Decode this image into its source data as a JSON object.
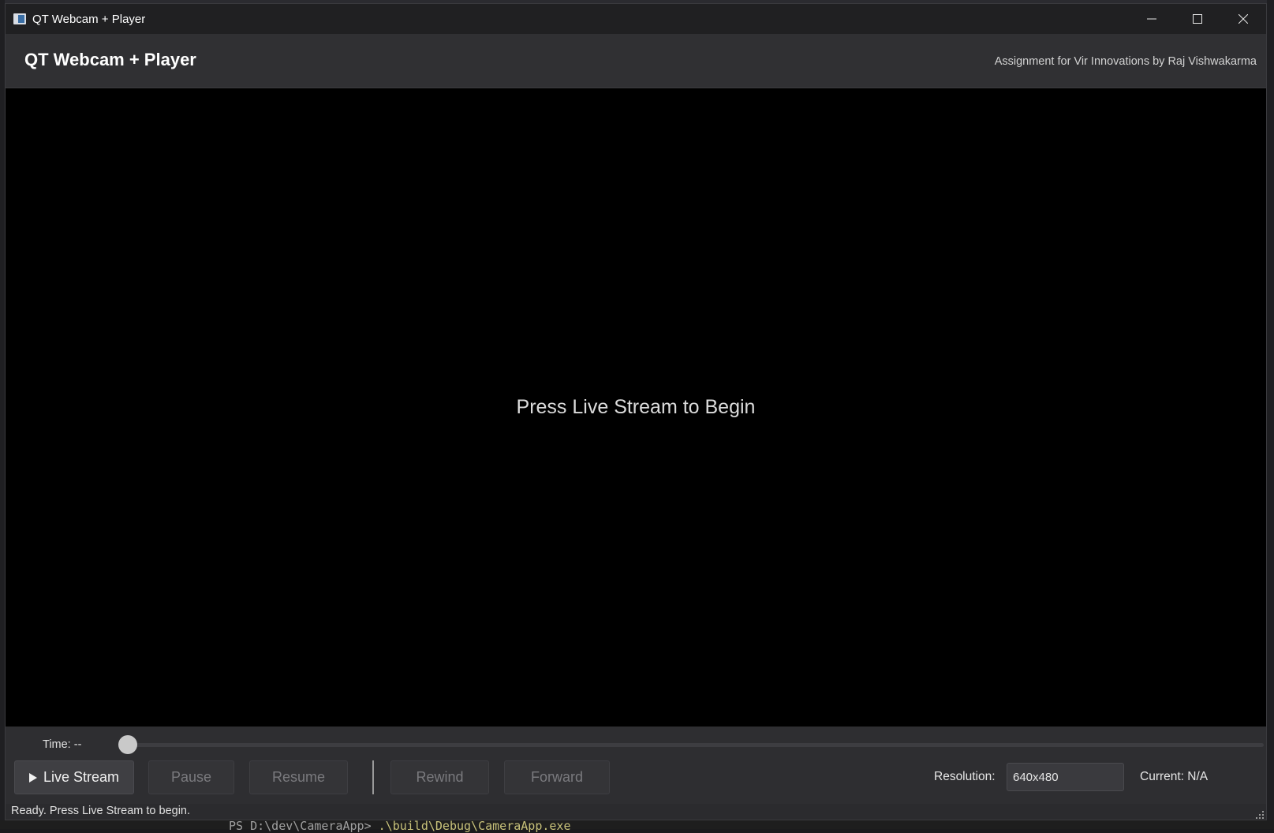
{
  "window": {
    "title": "QT Webcam + Player"
  },
  "header": {
    "title": "QT Webcam + Player",
    "credit": "Assignment for Vir Innovations by Raj Vishwakarma"
  },
  "video": {
    "message": "Press Live Stream to Begin"
  },
  "controls": {
    "time_label": "Time: --",
    "seek_position": 0,
    "buttons": {
      "live_stream": "Live Stream",
      "pause": "Pause",
      "resume": "Resume",
      "rewind": "Rewind",
      "forward": "Forward"
    },
    "resolution_label": "Resolution:",
    "resolution_value": "640x480",
    "current_label": "Current: N/A"
  },
  "status": {
    "text": "Ready. Press Live Stream to begin."
  },
  "background": {
    "terminal_prompt": "PS D:\\dev\\CameraApp>",
    "terminal_command": ".\\build\\Debug\\CameraApp.exe"
  },
  "colors": {
    "video_bg": "#000000",
    "panel_bg": "#2e2e31",
    "accent_text": "#ffffff"
  }
}
